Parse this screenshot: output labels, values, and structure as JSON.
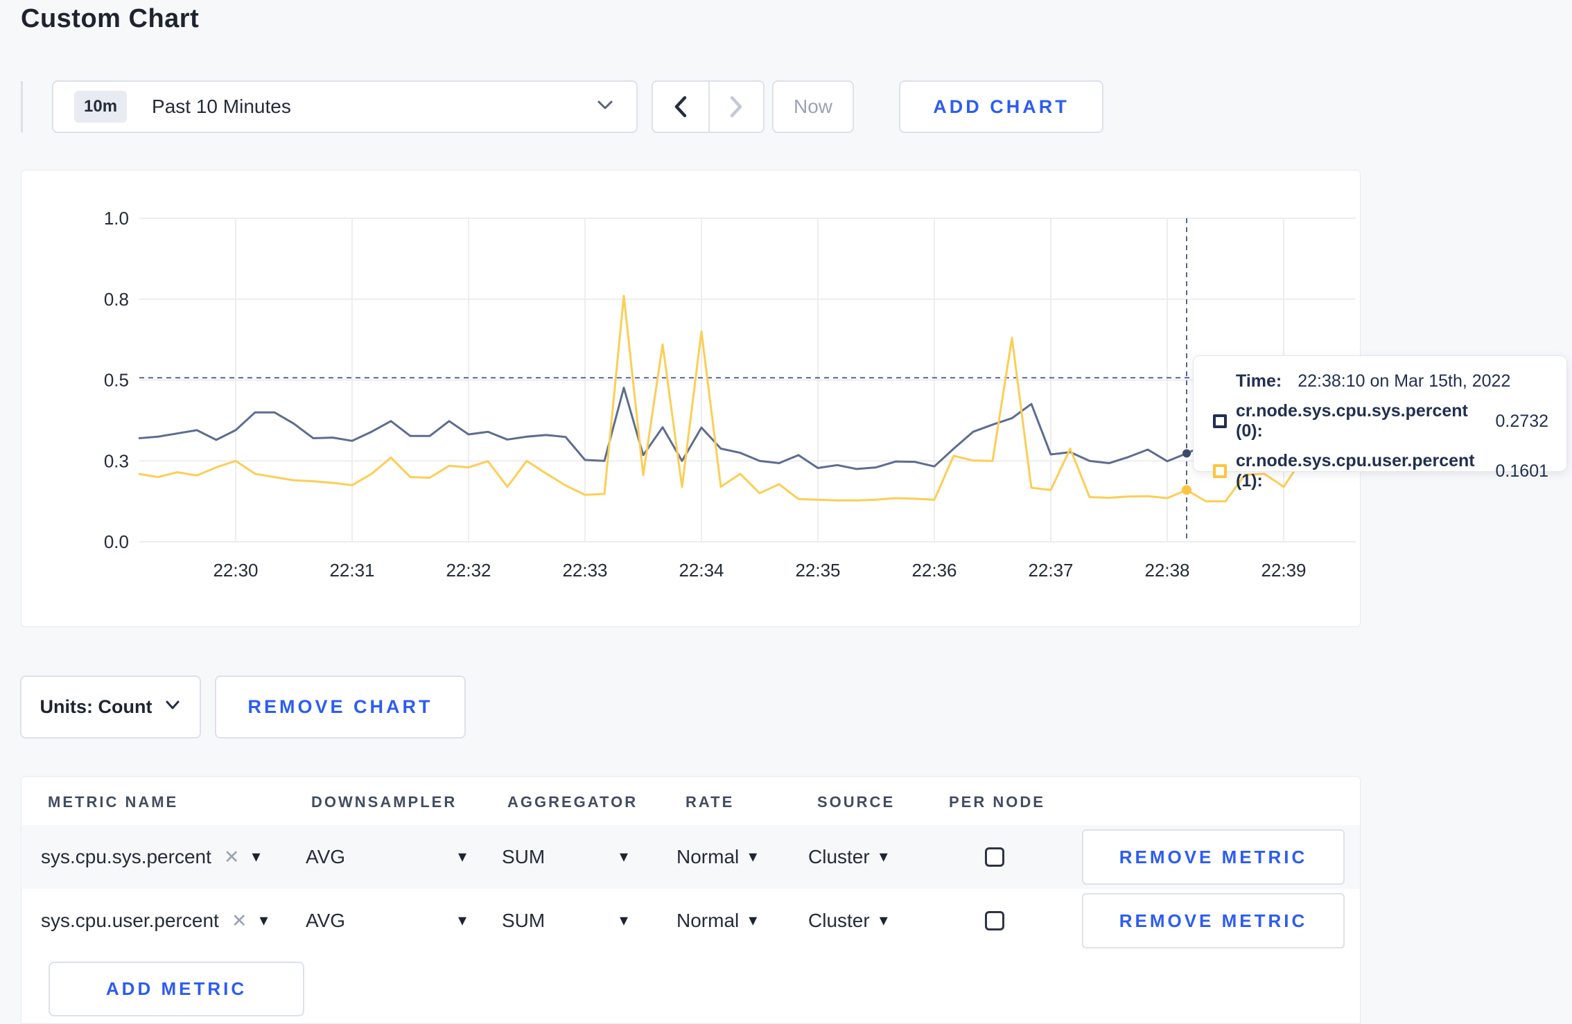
{
  "page": {
    "title": "Custom Chart"
  },
  "toolbar": {
    "range_badge": "10m",
    "range_label": "Past 10 Minutes",
    "now_label": "Now",
    "add_chart_label": "ADD CHART"
  },
  "chart": {
    "tooltip": {
      "time_label": "Time:",
      "time_value": "22:38:10 on Mar 15th, 2022",
      "rows": [
        {
          "label": "cr.node.sys.cpu.sys.percent (0):",
          "value": "0.2732",
          "color": "#222d52"
        },
        {
          "label": "cr.node.sys.cpu.user.percent (1):",
          "value": "0.1601",
          "color": "#ffc43d"
        }
      ]
    }
  },
  "chart_data": {
    "type": "line",
    "title": "",
    "xlabel": "",
    "ylabel": "",
    "ylim": [
      0,
      1
    ],
    "grid": true,
    "legend_position": "tooltip-only",
    "y_tick_values": [
      0,
      0.25,
      0.5,
      0.75,
      1.0
    ],
    "y_tick_labels": [
      "0.0",
      "0.3",
      "0.5",
      "0.8",
      "1.0"
    ],
    "x_ticks": [
      "22:30",
      "22:31",
      "22:32",
      "22:33",
      "22:34",
      "22:35",
      "22:36",
      "22:37",
      "22:38",
      "22:39"
    ],
    "x": [
      "22:29:10",
      "22:29:20",
      "22:29:30",
      "22:29:40",
      "22:29:50",
      "22:30:00",
      "22:30:10",
      "22:30:20",
      "22:30:30",
      "22:30:40",
      "22:30:50",
      "22:31:00",
      "22:31:10",
      "22:31:20",
      "22:31:30",
      "22:31:40",
      "22:31:50",
      "22:32:00",
      "22:32:10",
      "22:32:20",
      "22:32:30",
      "22:32:40",
      "22:32:50",
      "22:33:00",
      "22:33:10",
      "22:33:20",
      "22:33:30",
      "22:33:40",
      "22:33:50",
      "22:34:00",
      "22:34:10",
      "22:34:20",
      "22:34:30",
      "22:34:40",
      "22:34:50",
      "22:35:00",
      "22:35:10",
      "22:35:20",
      "22:35:30",
      "22:35:40",
      "22:35:50",
      "22:36:00",
      "22:36:10",
      "22:36:20",
      "22:36:30",
      "22:36:40",
      "22:36:50",
      "22:37:00",
      "22:37:10",
      "22:37:20",
      "22:37:30",
      "22:37:40",
      "22:37:50",
      "22:38:00",
      "22:38:10",
      "22:38:20",
      "22:38:30",
      "22:38:40",
      "22:38:50",
      "22:39:00",
      "22:39:10",
      "22:39:20"
    ],
    "series": [
      {
        "name": "cr.node.sys.cpu.sys.percent",
        "color": "#5d6d8e",
        "values": [
          0.32,
          0.325,
          0.335,
          0.345,
          0.315,
          0.345,
          0.4,
          0.4,
          0.365,
          0.32,
          0.322,
          0.312,
          0.34,
          0.373,
          0.327,
          0.327,
          0.373,
          0.332,
          0.34,
          0.316,
          0.325,
          0.33,
          0.324,
          0.253,
          0.25,
          0.476,
          0.268,
          0.354,
          0.25,
          0.353,
          0.288,
          0.275,
          0.25,
          0.243,
          0.268,
          0.228,
          0.237,
          0.225,
          0.23,
          0.248,
          0.247,
          0.233,
          0.288,
          0.34,
          0.362,
          0.382,
          0.426,
          0.27,
          0.277,
          0.25,
          0.243,
          0.262,
          0.285,
          0.249,
          0.2732,
          0.3,
          0.295,
          0.31,
          0.3,
          0.302,
          0.298,
          0.31
        ]
      },
      {
        "name": "cr.node.sys.cpu.user.percent",
        "color": "#fcce55",
        "values": [
          0.21,
          0.2,
          0.215,
          0.205,
          0.23,
          0.25,
          0.21,
          0.2,
          0.19,
          0.187,
          0.182,
          0.175,
          0.21,
          0.26,
          0.2,
          0.198,
          0.235,
          0.23,
          0.249,
          0.17,
          0.25,
          0.211,
          0.174,
          0.145,
          0.148,
          0.76,
          0.206,
          0.61,
          0.169,
          0.65,
          0.17,
          0.21,
          0.15,
          0.178,
          0.132,
          0.13,
          0.128,
          0.128,
          0.13,
          0.135,
          0.133,
          0.13,
          0.266,
          0.251,
          0.25,
          0.63,
          0.167,
          0.16,
          0.288,
          0.138,
          0.136,
          0.14,
          0.141,
          0.135,
          0.1601,
          0.125,
          0.125,
          0.207,
          0.21,
          0.17,
          0.26,
          0.27
        ]
      }
    ],
    "crosshair": {
      "time": "22:38:10",
      "y_value": 0.507,
      "marker_values": [
        0.2732,
        0.1601
      ]
    }
  },
  "units_bar": {
    "units_label": "Units: Count",
    "remove_chart_label": "REMOVE CHART"
  },
  "metrics_table": {
    "headers": [
      "METRIC NAME",
      "DOWNSAMPLER",
      "AGGREGATOR",
      "RATE",
      "SOURCE",
      "PER NODE"
    ],
    "rows": [
      {
        "metric": "sys.cpu.sys.percent",
        "downsampler": "AVG",
        "aggregator": "SUM",
        "rate": "Normal",
        "source": "Cluster",
        "per_node_checked": false,
        "remove_label": "REMOVE METRIC"
      },
      {
        "metric": "sys.cpu.user.percent",
        "downsampler": "AVG",
        "aggregator": "SUM",
        "rate": "Normal",
        "source": "Cluster",
        "per_node_checked": false,
        "remove_label": "REMOVE METRIC"
      }
    ],
    "add_metric_label": "ADD METRIC"
  },
  "colors": {
    "accent_blue": "#2c5cf2",
    "grid": "#ededf0",
    "crosshair": "#54678d",
    "axis_text": "#242b3a"
  }
}
